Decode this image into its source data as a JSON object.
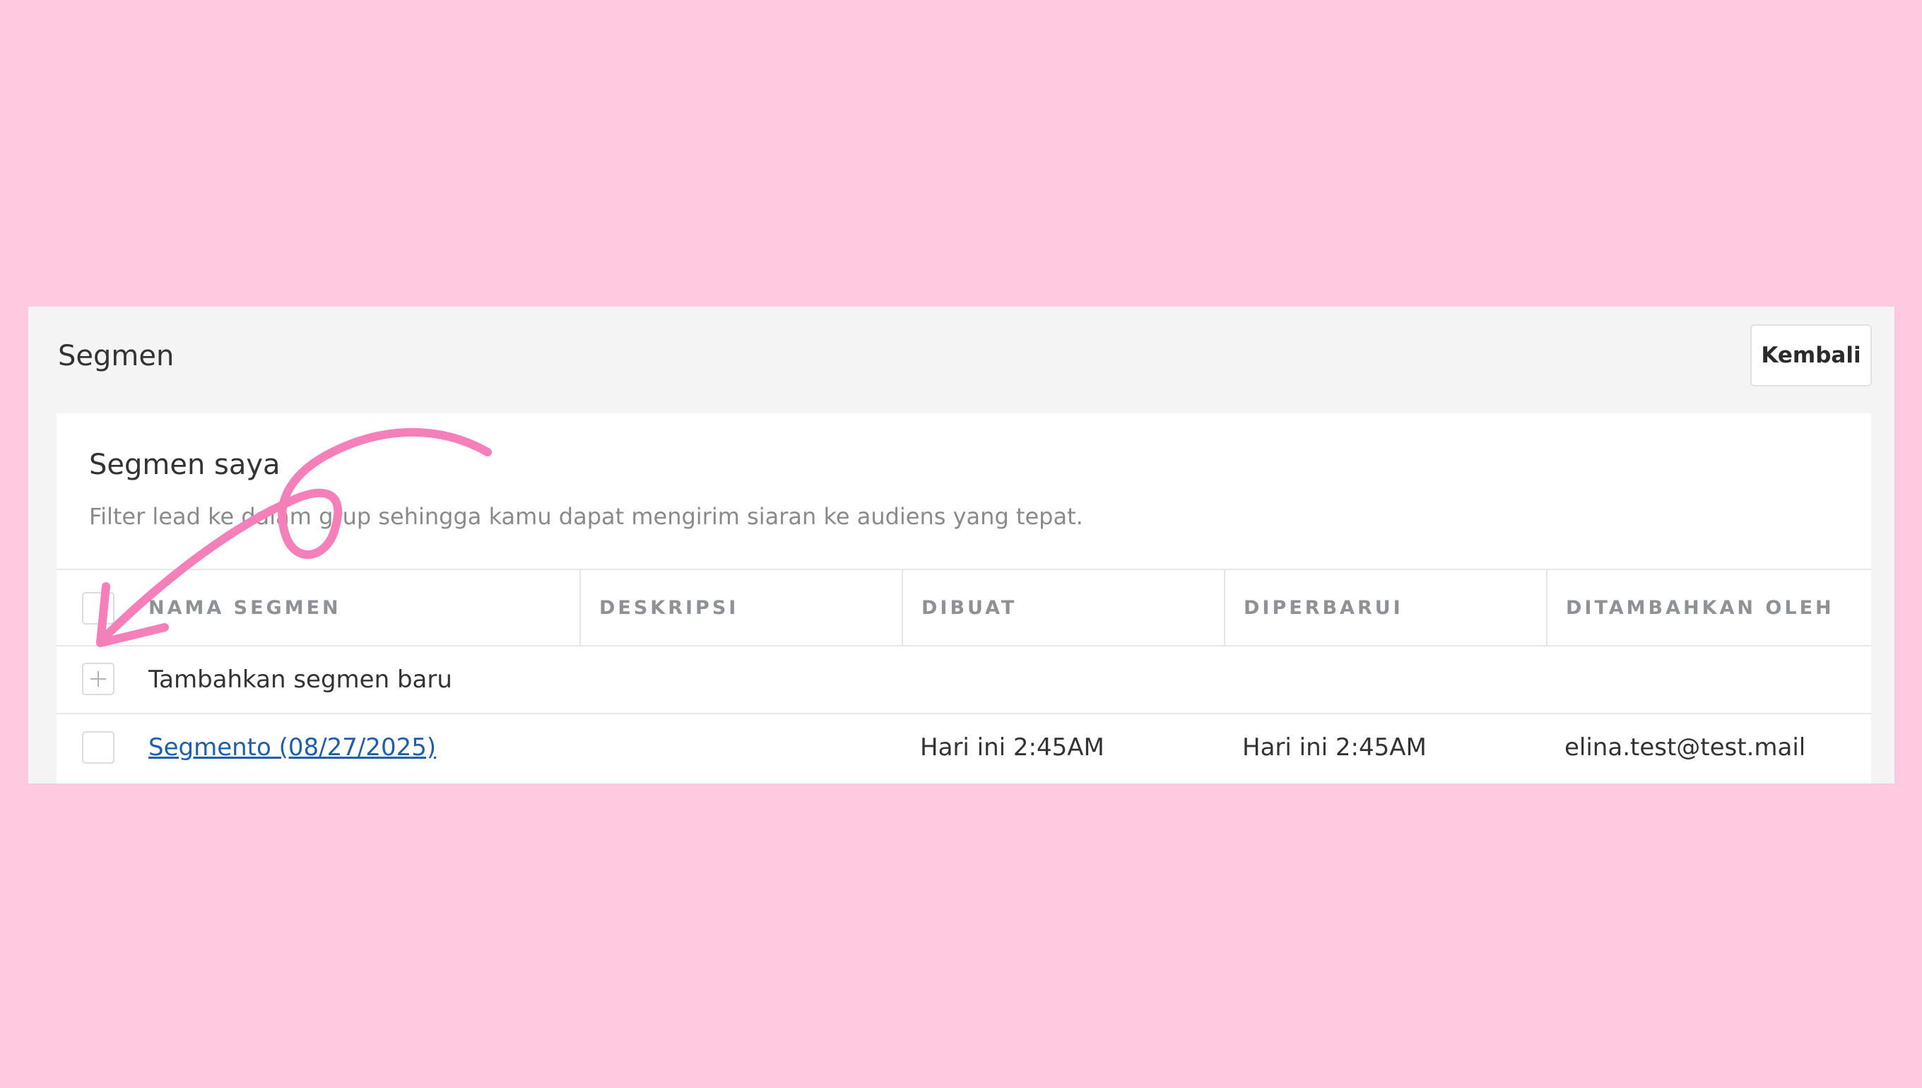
{
  "header": {
    "title": "Segmen",
    "back_label": "Kembali"
  },
  "card": {
    "title": "Segmen saya",
    "description": "Filter lead ke dalam grup sehingga kamu dapat mengirim siaran ke audiens yang tepat."
  },
  "table": {
    "columns": [
      "NAMA SEGMEN",
      "DESKRIPSI",
      "DIBUAT",
      "DIPERBARUI",
      "DITAMBAHKAN OLEH"
    ],
    "add_row_label": "Tambahkan segmen baru",
    "rows": [
      {
        "name": "Segmento (08/27/2025)",
        "description": "",
        "created": "Hari ini 2:45AM",
        "updated": "Hari ini 2:45AM",
        "added_by": "elina.test@test.mail"
      }
    ]
  },
  "colors": {
    "background": "#ffc9df",
    "annotation_arrow": "#f57fb8",
    "link": "#1d5fa8"
  },
  "icons": {
    "add": "plus-icon",
    "annotation": "curved-arrow-icon"
  }
}
